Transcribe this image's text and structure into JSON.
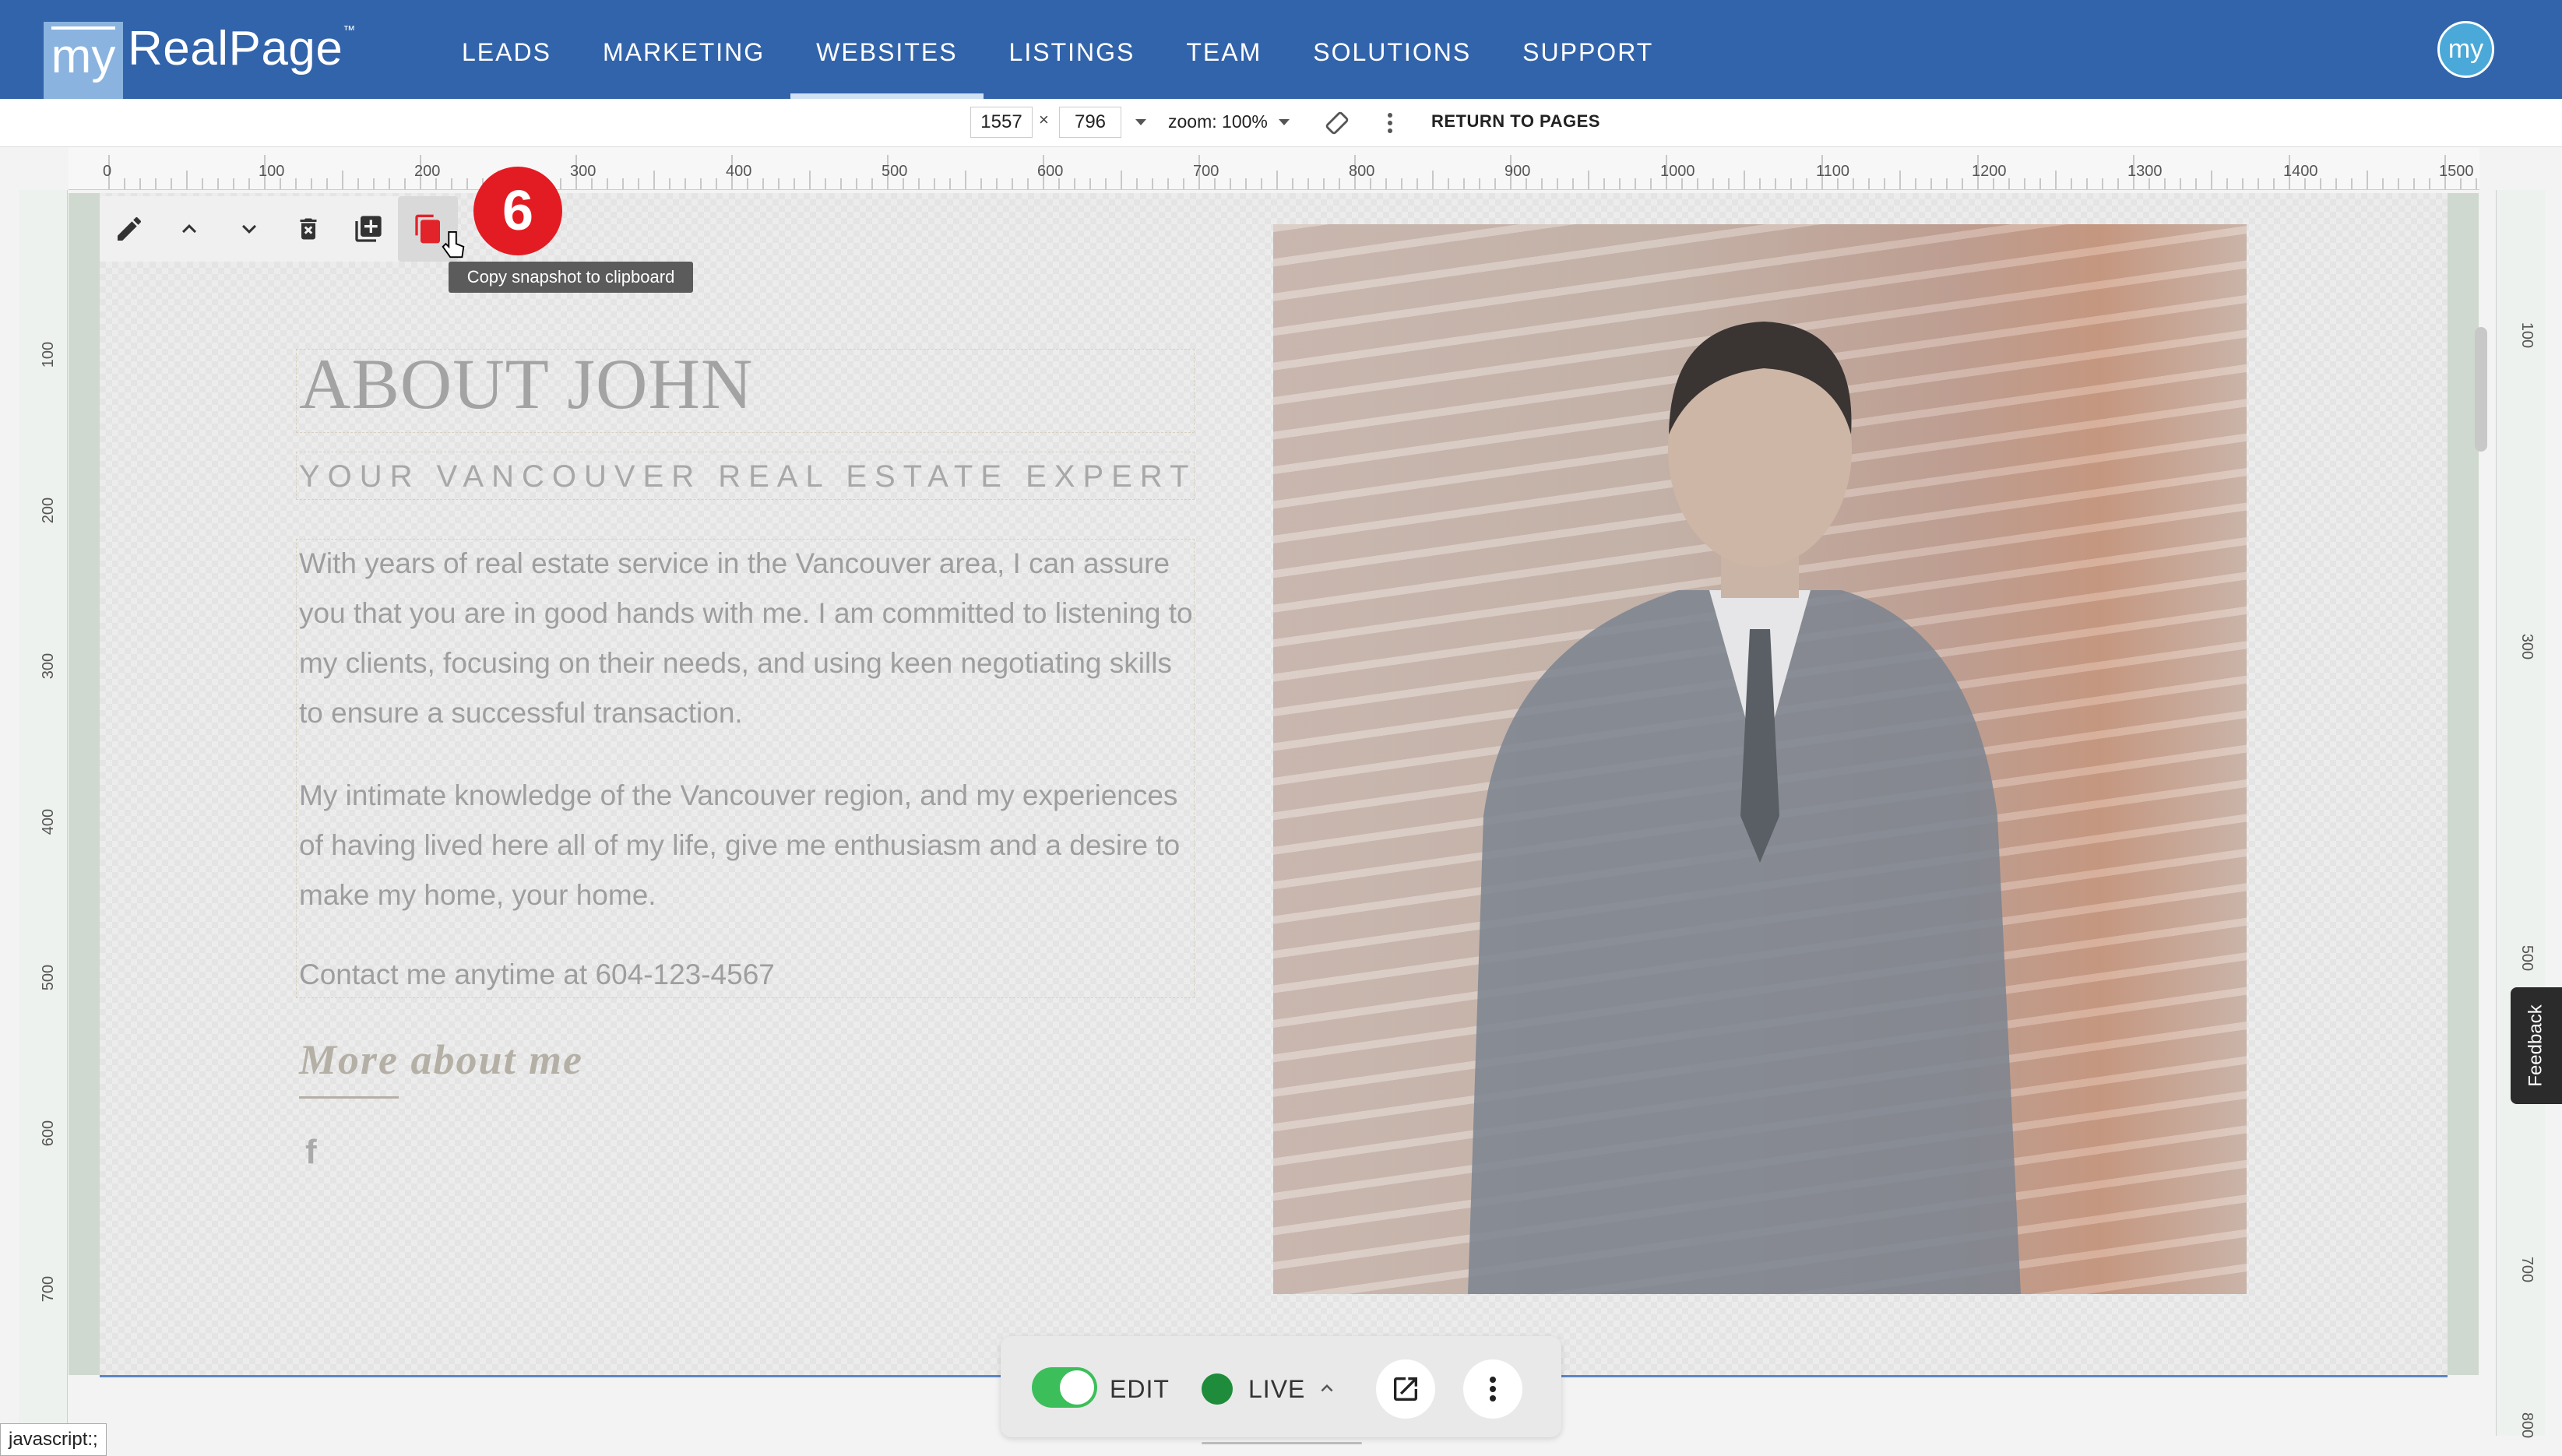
{
  "brand": {
    "logo_my": "my",
    "logo_text": "RealPage",
    "logo_tm": "™"
  },
  "nav": {
    "items": [
      {
        "label": "LEADS"
      },
      {
        "label": "MARKETING"
      },
      {
        "label": "WEBSITES"
      },
      {
        "label": "LISTINGS"
      },
      {
        "label": "TEAM"
      },
      {
        "label": "SOLUTIONS"
      },
      {
        "label": "SUPPORT"
      }
    ],
    "active": "WEBSITES"
  },
  "user_avatar": "my",
  "toolbar": {
    "width": "1557",
    "times": "×",
    "height": "796",
    "zoom_label": "zoom: 100%",
    "return_label": "RETURN TO PAGES"
  },
  "ruler": {
    "h": [
      "0",
      "100",
      "200",
      "300",
      "400",
      "500",
      "600",
      "700",
      "800",
      "900",
      "1000",
      "1100",
      "1200",
      "1300",
      "1400",
      "1500"
    ],
    "v": [
      "100",
      "200",
      "300",
      "400",
      "500",
      "600",
      "700",
      "800"
    ]
  },
  "element_toolbar": {
    "icons": [
      "pencil-icon",
      "chevron-up-icon",
      "chevron-down-icon",
      "delete-icon",
      "duplicate-icon",
      "copy-snapshot-icon"
    ],
    "step_badge": "6",
    "tooltip": "Copy snapshot to clipboard"
  },
  "content": {
    "title": "ABOUT JOHN",
    "subtitle": "YOUR VANCOUVER REAL ESTATE EXPERT",
    "paragraph1": "With years of real estate service in the Vancouver area, I can assure you that you are in good hands with me. I am committed to listening to my clients, focusing on their needs, and using keen negotiating skills to ensure a successful transaction.",
    "paragraph2": "My intimate knowledge of the Vancouver region, and my experiences of having lived here all of my life, give me enthusiasm and a desire to make my home, your home.",
    "contact": "Contact me anytime at 604-123-4567",
    "more_link": "More about me",
    "facebook_glyph": "f"
  },
  "bottom_bar": {
    "edit_label": "EDIT",
    "live_label": "LIVE"
  },
  "feedback_label": "Feedback",
  "status_text": "javascript:;",
  "colors": {
    "nav_bg": "#3264ab",
    "badge": "#e31b23",
    "toggle_on": "#3cbf5a",
    "globe": "#1e8c3a"
  }
}
